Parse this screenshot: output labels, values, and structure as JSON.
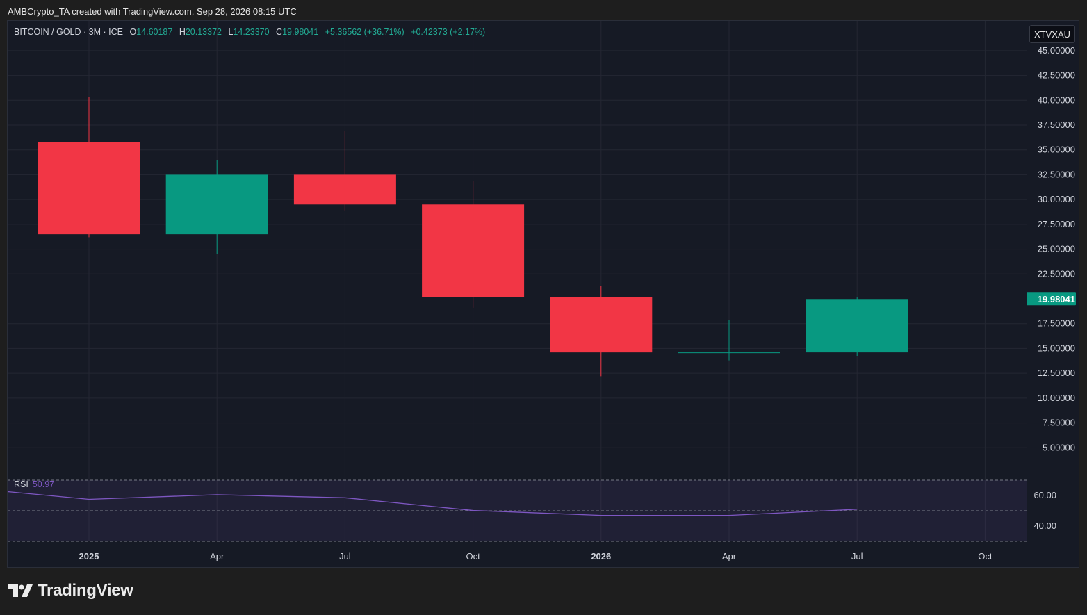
{
  "credit": "AMBCrypto_TA created with TradingView.com, Sep 28, 2026 08:15 UTC",
  "legend": {
    "symbol": "BITCOIN / GOLD · 3M · ICE",
    "open_label": "O",
    "open": "14.60187",
    "high_label": "H",
    "high": "20.13372",
    "low_label": "L",
    "low": "14.23370",
    "close_label": "C",
    "close": "19.98041",
    "change": "+5.36562 (+36.71%)",
    "change2": "+0.42373 (+2.17%)"
  },
  "symbol_badge": "XTVXAU",
  "rsi": {
    "label": "RSI",
    "value": "50.97"
  },
  "logo_text": "TradingView",
  "colors": {
    "up": "#089981",
    "down": "#f23645",
    "rsi_line": "#7e57c2",
    "bg": "#161a25",
    "grid": "#242733"
  },
  "chart_data": {
    "type": "candlestick",
    "series": [
      {
        "name": "BITCOIN / GOLD",
        "ohlc": [
          {
            "x": "2024-10",
            "open": 35.8,
            "high": 40.3,
            "low": 26.2,
            "close": 26.5
          },
          {
            "x": "2025-01",
            "open": 26.5,
            "high": 34.0,
            "low": 24.5,
            "close": 32.5
          },
          {
            "x": "2025-04",
            "open": 32.5,
            "high": 36.9,
            "low": 28.9,
            "close": 29.5
          },
          {
            "x": "2025-07",
            "open": 29.5,
            "high": 31.9,
            "low": 19.1,
            "close": 20.2
          },
          {
            "x": "2025-10",
            "open": 20.2,
            "high": 21.3,
            "low": 12.2,
            "close": 14.6
          },
          {
            "x": "2026-01",
            "open": 14.6,
            "high": 17.9,
            "low": 13.8,
            "close": 14.6
          },
          {
            "x": "2026-04",
            "open": 14.60187,
            "high": 20.13372,
            "low": 14.2337,
            "close": 19.98041
          }
        ]
      },
      {
        "name": "RSI",
        "values": [
          {
            "x": "2024-09",
            "y": 62.5
          },
          {
            "x": "2024-10",
            "y": 57.5
          },
          {
            "x": "2025-01",
            "y": 60.5
          },
          {
            "x": "2025-04",
            "y": 58.5
          },
          {
            "x": "2025-07",
            "y": 50.2
          },
          {
            "x": "2025-10",
            "y": 47.0
          },
          {
            "x": "2026-01",
            "y": 47.0
          },
          {
            "x": "2026-04",
            "y": 50.97
          }
        ]
      }
    ],
    "price_ylim": [
      2.5,
      48
    ],
    "price_yticks": [
      "45.00000",
      "42.50000",
      "40.00000",
      "37.50000",
      "35.00000",
      "32.50000",
      "30.00000",
      "27.50000",
      "25.00000",
      "22.50000",
      "17.50000",
      "15.00000",
      "12.50000",
      "10.00000",
      "7.50000",
      "5.00000"
    ],
    "last_price_label": "19.98041",
    "rsi_ylim": [
      30,
      70
    ],
    "rsi_band": [
      70,
      30
    ],
    "rsi_yticks": [
      "60.00",
      "40.00"
    ],
    "x_ticks": [
      {
        "x": "2024-10",
        "label": "2025",
        "bold": true
      },
      {
        "x": "2025-01",
        "label": "Apr"
      },
      {
        "x": "2025-04",
        "label": "Jul"
      },
      {
        "x": "2025-07",
        "label": "Oct"
      },
      {
        "x": "2025-10",
        "label": "2026",
        "bold": true
      },
      {
        "x": "2026-01",
        "label": "Apr"
      },
      {
        "x": "2026-04",
        "label": "Jul"
      },
      {
        "x": "2026-07",
        "label": "Oct"
      }
    ],
    "grid": true,
    "scale": "linear"
  }
}
